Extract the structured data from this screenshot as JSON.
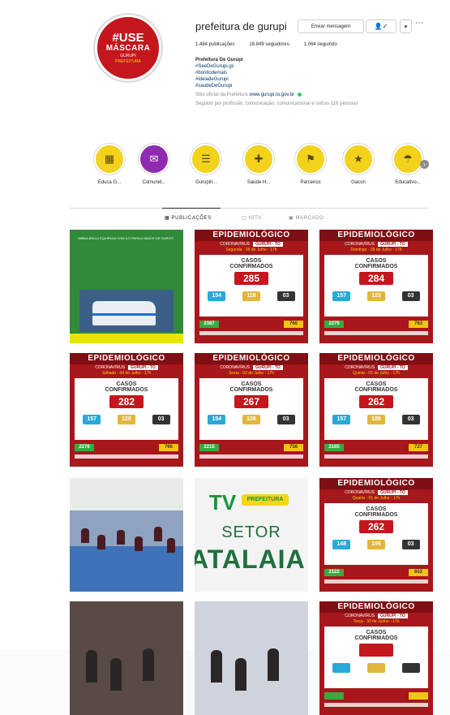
{
  "profile": {
    "avatar": {
      "line1": "#USE",
      "line2": "MÁSCARA",
      "line3": "GURUPI",
      "line4": "PREFEITURA"
    },
    "username": "prefeitura de gurupi",
    "message_label": "Enviar mensagem",
    "follow_icon": "person-check-icon",
    "arrow_icon": "chevron-down-icon",
    "more_icon": "ellipsis-icon",
    "stats": {
      "posts": "1.484 publicações",
      "followers": "18.849 seguidores",
      "following": "1.064 seguindo"
    },
    "bio": {
      "name": "Prefeitura De Gurupi",
      "lines": [
        "#SeeDeGurupi.gc",
        "#bonitodemais",
        "#ideiadeGurupi",
        "#saudeDeGurupi"
      ],
      "link_prefix": "Sitio oficial da Prefeitura",
      "link": "www.gurupi.to.gov.br",
      "followed_by": "Seguido por profissão, comunicação, comunicacional e outras 116 pessoas"
    }
  },
  "highlights": [
    {
      "label": "Educa G...",
      "icon": "book-icon"
    },
    {
      "label": "Comunid...",
      "icon": "chat-icon"
    },
    {
      "label": "Gurupiti...",
      "icon": "list-icon"
    },
    {
      "label": "Saúde H...",
      "icon": "plus-circle-icon"
    },
    {
      "label": "Parceiros",
      "icon": "handshake-icon"
    },
    {
      "label": "Gacon",
      "icon": "star-icon"
    },
    {
      "label": "Educativo...",
      "icon": "umbrella-icon"
    }
  ],
  "tabs": {
    "posts": "PUBLICAÇÕES",
    "igtv": "IGTV",
    "tagged": "MARCADO"
  },
  "epi": {
    "banner": "EPIDEMIOLÓGICO",
    "subtitle": "CORONAVÍRUS",
    "city": "GURUPI - TO",
    "casos": "CASOS",
    "confirmados": "CONFIRMADOS"
  },
  "posts": [
    {
      "kind": "green",
      "text": "AMBULÂNCIA EQUIPADA COM UTI PARA A SAÚDE DE GURUPI"
    },
    {
      "kind": "epi",
      "date": "Segunda - 06 de Julho - 17h",
      "total": "285",
      "a": "154",
      "b": "118",
      "c": "03",
      "g": "2387",
      "y": "766"
    },
    {
      "kind": "epi",
      "date": "Domingo - 05 de Julho - 17h",
      "total": "284",
      "a": "157",
      "b": "123",
      "c": "03",
      "g": "2279",
      "y": "763"
    },
    {
      "kind": "epi",
      "date": "Sábado - 04 de Julho - 17h",
      "total": "282",
      "a": "157",
      "b": "120",
      "c": "03",
      "g": "2276",
      "y": "766"
    },
    {
      "kind": "epi",
      "date": "Sexta - 03 de Julho - 17h",
      "total": "267",
      "a": "154",
      "b": "108",
      "c": "03",
      "g": "2215",
      "y": "756"
    },
    {
      "kind": "epi",
      "date": "Quinta - 02 de Julho - 17h",
      "total": "262",
      "a": "157",
      "b": "100",
      "c": "03",
      "g": "2165",
      "y": "727"
    },
    {
      "kind": "photo"
    },
    {
      "kind": "tv",
      "tv": "TV",
      "pref": "PREFEITURA",
      "setor": "SETOR",
      "atalaia": "ATALAIA"
    },
    {
      "kind": "epi",
      "date": "Quarta - 01 de Julho - 17h",
      "total": "262",
      "a": "148",
      "b": "106",
      "c": "03",
      "g": "2122",
      "y": "602"
    },
    {
      "kind": "dark"
    },
    {
      "kind": "dark2"
    },
    {
      "kind": "epi",
      "date": "Terça - 30 de Junho - 17h",
      "total": "",
      "a": "",
      "b": "",
      "c": "",
      "g": "",
      "y": ""
    }
  ]
}
